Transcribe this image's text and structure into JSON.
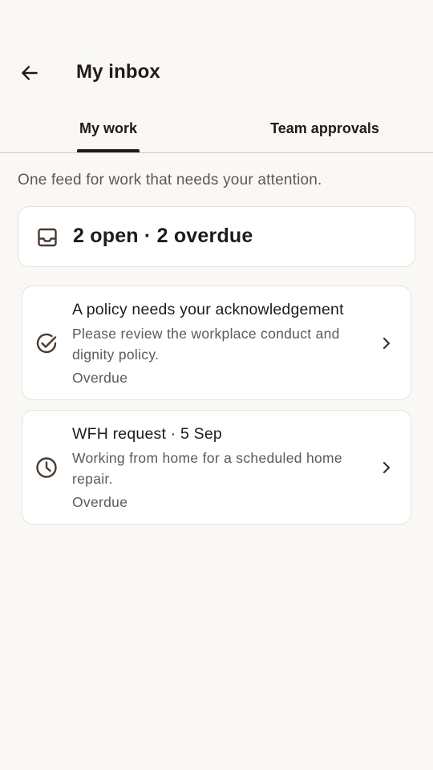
{
  "header": {
    "title": "My inbox",
    "back_icon": "arrow-left-icon"
  },
  "tabs": [
    {
      "label": "My work",
      "selected": true
    },
    {
      "label": "Team approvals",
      "selected": false
    }
  ],
  "subtitle": "One feed for work that needs your attention.",
  "summary": {
    "icon": "inbox-icon",
    "text": "2 open · 2 overdue"
  },
  "items": [
    {
      "icon": "check-circle-icon",
      "title": "A policy needs your acknowledgement",
      "description": "Please review the workplace conduct and dignity policy.",
      "status": "Overdue"
    },
    {
      "icon": "clock-icon",
      "title": "WFH request · 5 Sep",
      "description": "Working from home for a scheduled home repair.",
      "status": "Overdue"
    }
  ],
  "colors": {
    "background": "#faf8f5",
    "card": "#ffffff",
    "text_primary": "#1f1b18",
    "text_secondary": "#5f5853",
    "icon_brown": "#4a3b33",
    "border": "#e6e1dc"
  }
}
